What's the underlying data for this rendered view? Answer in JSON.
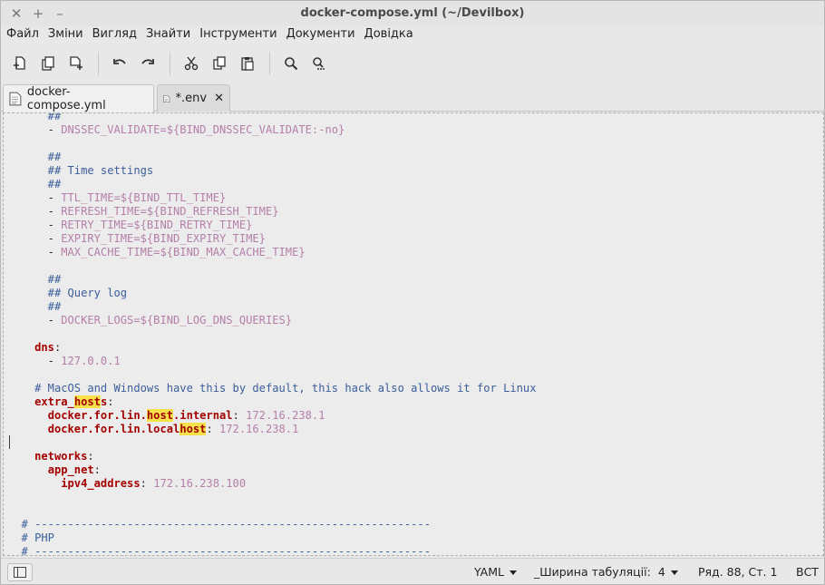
{
  "window": {
    "title": "docker-compose.yml (~/Devilbox)",
    "controls": {
      "close": "✕",
      "maximize": "+",
      "minimize": "–"
    }
  },
  "menu": [
    "Файл",
    "Зміни",
    "Вигляд",
    "Знайти",
    "Інструменти",
    "Документи",
    "Довідка"
  ],
  "toolbar": {
    "buttons": [
      "new-document-icon",
      "open-document-icon",
      "save-document-icon",
      "undo-icon",
      "redo-icon",
      "cut-icon",
      "copy-icon",
      "paste-icon",
      "search-icon",
      "search-replace-icon"
    ]
  },
  "tabs": [
    {
      "label": "docker-compose.yml",
      "active": true
    },
    {
      "label": "*.env",
      "active": false
    }
  ],
  "editor": {
    "lines": [
      [
        [
          "c",
          "      ##"
        ]
      ],
      [
        [
          "p",
          "      - "
        ],
        [
          "v",
          "DNSSEC_VALIDATE=${BIND_DNSSEC_VALIDATE:-no}"
        ]
      ],
      [
        [
          "p",
          ""
        ]
      ],
      [
        [
          "c",
          "      ##"
        ]
      ],
      [
        [
          "c",
          "      ## Time settings"
        ]
      ],
      [
        [
          "c",
          "      ##"
        ]
      ],
      [
        [
          "p",
          "      - "
        ],
        [
          "v",
          "TTL_TIME=${BIND_TTL_TIME}"
        ]
      ],
      [
        [
          "p",
          "      - "
        ],
        [
          "v",
          "REFRESH_TIME=${BIND_REFRESH_TIME}"
        ]
      ],
      [
        [
          "p",
          "      - "
        ],
        [
          "v",
          "RETRY_TIME=${BIND_RETRY_TIME}"
        ]
      ],
      [
        [
          "p",
          "      - "
        ],
        [
          "v",
          "EXPIRY_TIME=${BIND_EXPIRY_TIME}"
        ]
      ],
      [
        [
          "p",
          "      - "
        ],
        [
          "v",
          "MAX_CACHE_TIME=${BIND_MAX_CACHE_TIME}"
        ]
      ],
      [
        [
          "p",
          ""
        ]
      ],
      [
        [
          "c",
          "      ##"
        ]
      ],
      [
        [
          "c",
          "      ## Query log"
        ]
      ],
      [
        [
          "c",
          "      ##"
        ]
      ],
      [
        [
          "p",
          "      - "
        ],
        [
          "v",
          "DOCKER_LOGS=${BIND_LOG_DNS_QUERIES}"
        ]
      ],
      [
        [
          "p",
          ""
        ]
      ],
      [
        [
          "p",
          "    "
        ],
        [
          "k",
          "dns"
        ],
        [
          "p",
          ":"
        ]
      ],
      [
        [
          "p",
          "      - "
        ],
        [
          "v",
          "127.0.0.1"
        ]
      ],
      [
        [
          "p",
          ""
        ]
      ],
      [
        [
          "c",
          "    # MacOS and Windows have this by default, this hack also allows it for Linux"
        ]
      ],
      [
        [
          "p",
          "    "
        ],
        [
          "k",
          "extra_"
        ],
        [
          "kh",
          "host"
        ],
        [
          "k",
          "s"
        ],
        [
          "p",
          ":"
        ]
      ],
      [
        [
          "p",
          "      "
        ],
        [
          "k",
          "docker.for.lin."
        ],
        [
          "kh",
          "host"
        ],
        [
          "k",
          ".internal"
        ],
        [
          "p",
          ": "
        ],
        [
          "v",
          "172.16.238.1"
        ]
      ],
      [
        [
          "p",
          "      "
        ],
        [
          "k",
          "docker.for.lin.local"
        ],
        [
          "kh",
          "host"
        ],
        [
          "p",
          ": "
        ],
        [
          "v",
          "172.16.238.1"
        ]
      ],
      [
        [
          "p",
          ""
        ]
      ],
      [
        [
          "p",
          "    "
        ],
        [
          "k",
          "networks"
        ],
        [
          "p",
          ":"
        ]
      ],
      [
        [
          "p",
          "      "
        ],
        [
          "k",
          "app_net"
        ],
        [
          "p",
          ":"
        ]
      ],
      [
        [
          "p",
          "        "
        ],
        [
          "k",
          "ipv4_address"
        ],
        [
          "p",
          ": "
        ],
        [
          "v",
          "172.16.238.100"
        ]
      ],
      [
        [
          "p",
          ""
        ]
      ],
      [
        [
          "p",
          ""
        ]
      ],
      [
        [
          "c",
          "  # ------------------------------------------------------------"
        ]
      ],
      [
        [
          "c",
          "  # PHP"
        ]
      ],
      [
        [
          "c",
          "  # ------------------------------------------------------------"
        ]
      ]
    ]
  },
  "statusbar": {
    "language": "YAML",
    "tab_width_label": "_Ширина табуляції:",
    "tab_width_value": "4",
    "position": "Ряд. 88, Ст. 1",
    "insert_mode": "ВСТ"
  }
}
